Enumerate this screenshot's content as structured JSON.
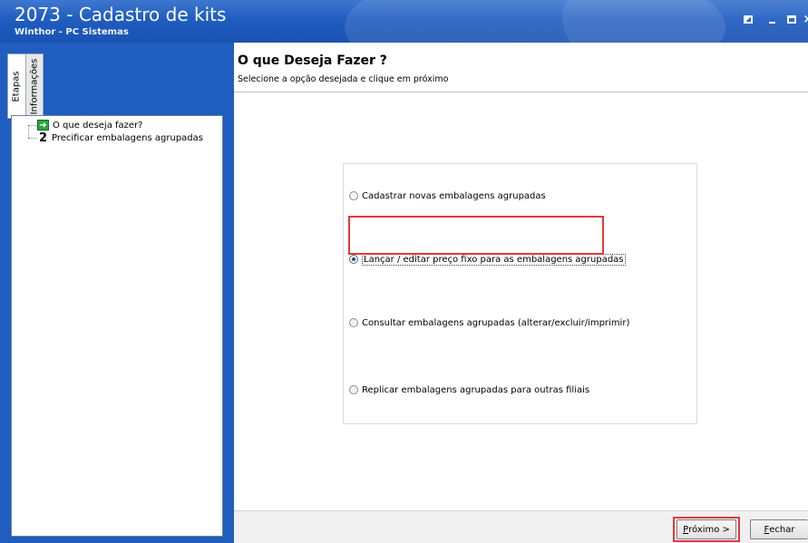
{
  "window": {
    "title": "2073 - Cadastro de kits",
    "subtitle": "Winthor - PC Sistemas",
    "controls": [
      "restore-icon",
      "minimize-icon",
      "maximize-icon",
      "close-icon"
    ],
    "close_glyph": "×"
  },
  "sidebar": {
    "tabs": [
      {
        "label": "Etapas",
        "active": true
      },
      {
        "label": "Informações",
        "active": false
      }
    ],
    "steps": [
      {
        "marker": "arrow",
        "label": "O que deseja fazer?"
      },
      {
        "marker": "2",
        "label": "Precificar embalagens agrupadas"
      }
    ],
    "arrow_glyph": "➜"
  },
  "main": {
    "title": "O que Deseja Fazer ?",
    "subtitle": "Selecione a opção desejada e clique em próximo",
    "options": [
      {
        "label": "Cadastrar novas embalagens agrupadas",
        "selected": false
      },
      {
        "label": "Lançar / editar preço fixo para as embalagens agrupadas",
        "selected": true
      },
      {
        "label": "Consultar embalagens agrupadas (alterar/excluir/imprimir)",
        "selected": false
      },
      {
        "label": "Replicar embalagens agrupadas para outras filiais",
        "selected": false
      }
    ]
  },
  "footer": {
    "next_label_u": "P",
    "next_label_rest": "róximo >",
    "close_label_u": "F",
    "close_label_rest": "echar"
  },
  "colors": {
    "titlebar": "#1f5dbf",
    "highlight": "#e23a3a"
  }
}
